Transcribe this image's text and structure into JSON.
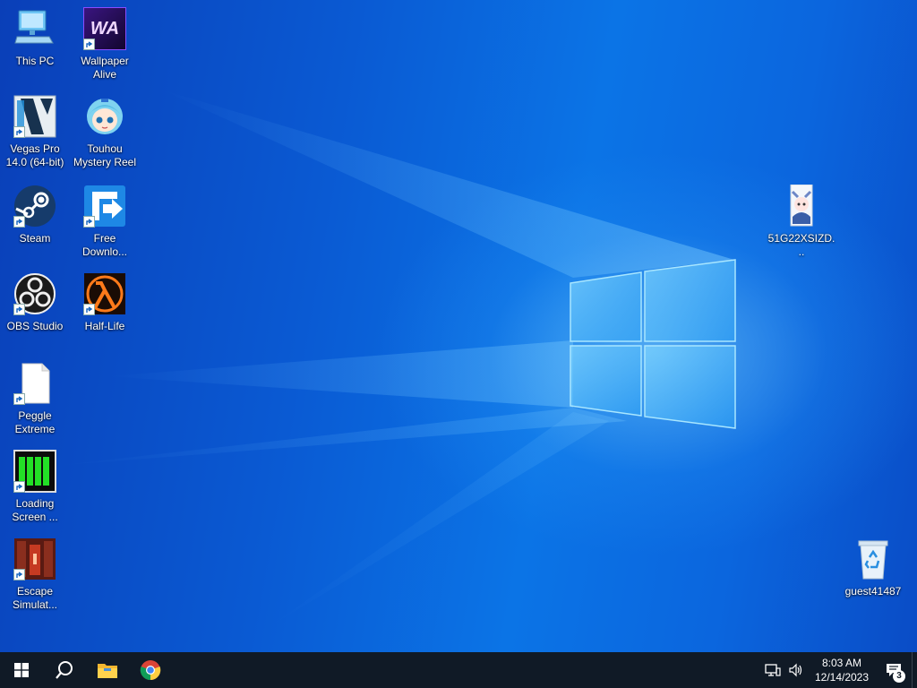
{
  "desktop": {
    "icons": [
      {
        "label": "This PC"
      },
      {
        "label": "Wallpaper Alive"
      },
      {
        "label": "Vegas Pro 14.0 (64-bit)"
      },
      {
        "label": "Touhou Mystery Reel"
      },
      {
        "label": "Steam"
      },
      {
        "label": "Free Downlo..."
      },
      {
        "label": "OBS Studio"
      },
      {
        "label": "Half-Life"
      },
      {
        "label": "Peggle Extreme"
      },
      {
        "label": "Loading Screen ..."
      },
      {
        "label": "Escape Simulat..."
      },
      {
        "label": "51G22XSIZD..."
      },
      {
        "label": "guest41487"
      }
    ]
  },
  "icon_glyphs": {
    "wallpaper_alive": "WA"
  },
  "taskbar": {
    "time": "8:03 AM",
    "date": "12/14/2023",
    "notification_count": "3"
  },
  "colors": {
    "taskbar": "#101a26",
    "desktop_blue": "#0a5fd6",
    "logo_light": "#8fdcff"
  }
}
